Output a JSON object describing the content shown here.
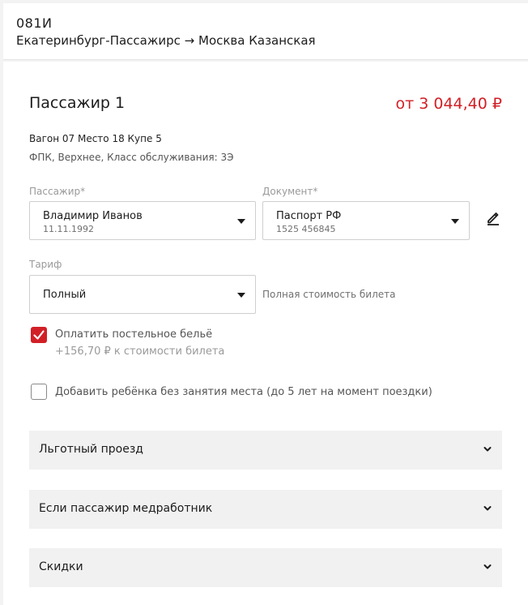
{
  "header": {
    "train_number": "081И",
    "route": "Екатеринбург-Пассажирс → Москва Казанская"
  },
  "passenger": {
    "title": "Пассажир 1",
    "price": "от 3 044,40 ₽",
    "seat_info": "Вагон 07 Место 18 Купе 5",
    "class_info": "ФПК, Верхнее, Класс обслуживания: 3Э"
  },
  "form": {
    "passenger_label": "Пассажир*",
    "passenger_name": "Владимир Иванов",
    "passenger_birthdate": "11.11.1992",
    "document_label": "Документ*",
    "document_type": "Паспорт РФ",
    "document_number": "1525 456845",
    "tariff_label": "Тариф",
    "tariff_value": "Полный",
    "tariff_hint": "Полная стоимость билета"
  },
  "options": {
    "bedding_label": "Оплатить постельное бельё",
    "bedding_price": "+156,70 ₽ к стоимости билета",
    "bedding_checked": true,
    "child_label": "Добавить ребёнка без занятия места (до 5 лет на момент поездки)",
    "child_checked": false
  },
  "accordions": [
    {
      "label": "Льготный проезд"
    },
    {
      "label": "Если пассажир медработник"
    },
    {
      "label": "Скидки"
    }
  ],
  "colors": {
    "accent": "#d21f26",
    "accordion_bg": "#f1f1f1",
    "border": "#cfcfcf"
  },
  "icons": {
    "edit": "pencil-icon",
    "dropdown": "triangle-down-icon",
    "accordion": "chevron-down-icon",
    "check": "checkmark-icon"
  }
}
